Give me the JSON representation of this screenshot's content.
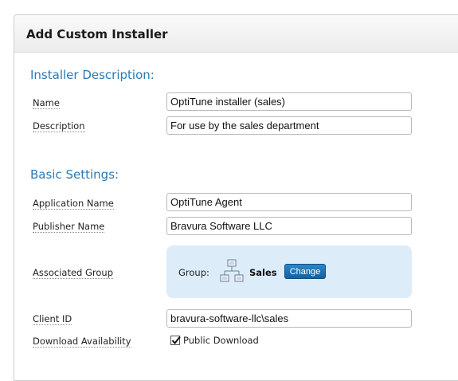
{
  "panel": {
    "title": "Add Custom Installer"
  },
  "installer_description": {
    "heading": "Installer Description:",
    "name_label": "Name",
    "name_value": "OptiTune installer (sales)",
    "description_label": "Description",
    "description_value": "For use by the sales department"
  },
  "basic_settings": {
    "heading": "Basic Settings:",
    "application_name_label": "Application Name",
    "application_name_value": "OptiTune Agent",
    "publisher_name_label": "Publisher Name",
    "publisher_name_value": "Bravura Software LLC",
    "associated_group_label": "Associated Group",
    "group": {
      "prefix": "Group:",
      "icon": "org-chart-icon",
      "name": "Sales",
      "change_button": "Change"
    },
    "client_id_label": "Client ID",
    "client_id_value": "bravura-software-llc\\sales",
    "download_availability_label": "Download Availability",
    "public_download_label": "Public Download",
    "public_download_checked": true
  },
  "colors": {
    "heading_blue": "#2a7ab5",
    "group_box_bg": "#dcecf9",
    "button_blue": "#1c6fb0"
  }
}
